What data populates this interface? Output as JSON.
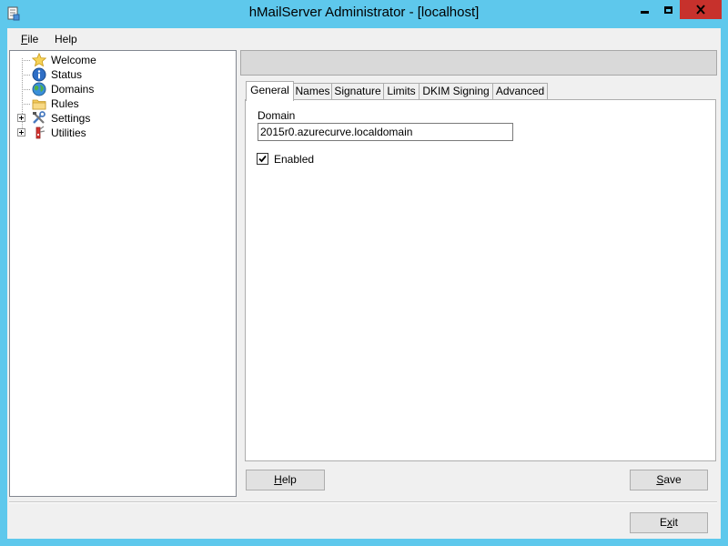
{
  "window": {
    "title": "hMailServer Administrator - [localhost]",
    "icon": "app-document-icon",
    "minimize_icon": "minimize-icon",
    "maximize_icon": "maximize-icon",
    "close_icon": "close-icon",
    "close_glyph": "✕"
  },
  "menu": {
    "file_mnemonic": "F",
    "file_rest": "ile",
    "help": "Help"
  },
  "tree": {
    "items": [
      {
        "label": "Welcome",
        "icon": "star-icon"
      },
      {
        "label": "Status",
        "icon": "info-icon"
      },
      {
        "label": "Domains",
        "icon": "globe-icon"
      },
      {
        "label": "Rules",
        "icon": "folder-icon"
      },
      {
        "label": "Settings",
        "icon": "tools-icon"
      },
      {
        "label": "Utilities",
        "icon": "utilities-icon"
      }
    ]
  },
  "tabs": [
    {
      "label": "General",
      "active": true
    },
    {
      "label": "Names"
    },
    {
      "label": "Signature"
    },
    {
      "label": "Limits"
    },
    {
      "label": "DKIM Signing"
    },
    {
      "label": "Advanced"
    }
  ],
  "general": {
    "domain_label": "Domain",
    "domain_value": "2015r0.azurecurve.localdomain",
    "enabled_label": "Enabled",
    "enabled_checked": true
  },
  "buttons": {
    "help_mnemonic": "H",
    "help_rest": "elp",
    "save_mnemonic": "S",
    "save_rest": "ave",
    "exit_pre": "E",
    "exit_mnemonic": "x",
    "exit_rest": "it"
  },
  "colors": {
    "titlebar": "#5ec8ec",
    "close_button": "#c7312c",
    "client_background": "#f0f0f0"
  }
}
